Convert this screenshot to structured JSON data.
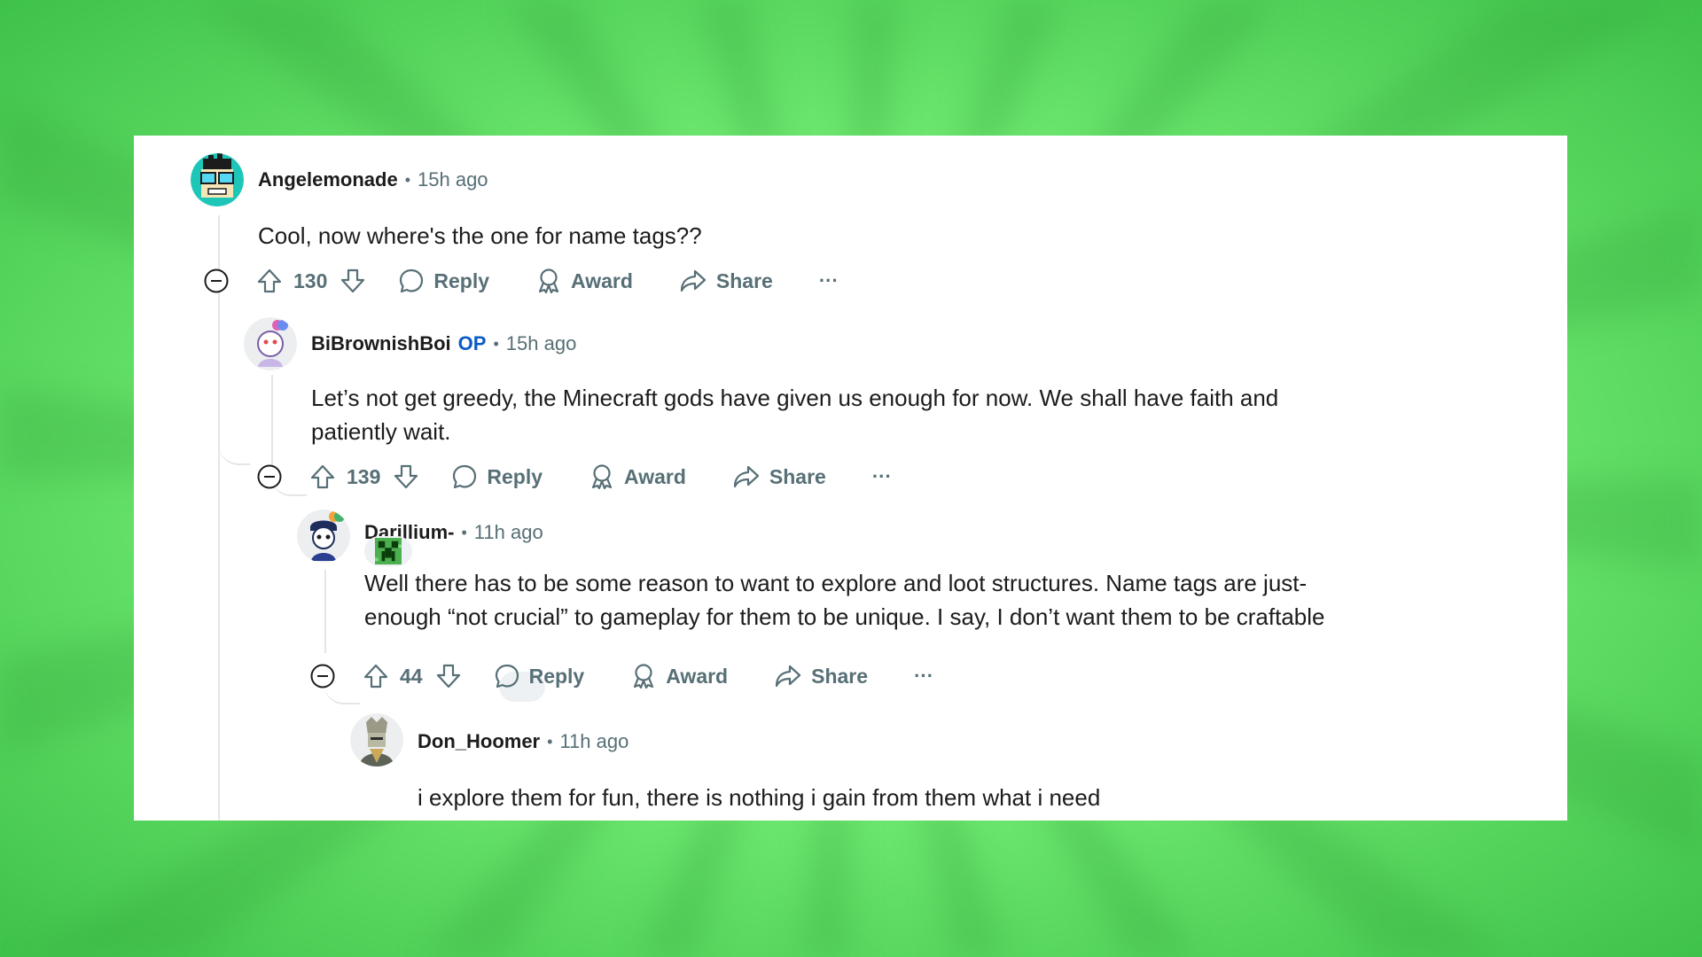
{
  "colors": {
    "background": "#7bf27a",
    "card": "#ffffff",
    "text": "#1c1c1c",
    "muted": "#576f76",
    "op_badge": "#0a5bc4",
    "thread_line": "#e3e6e8"
  },
  "comments": [
    {
      "author": "Angelemonade",
      "separator": "•",
      "time": "15h ago",
      "body": [
        "Cool, now where's the one for name tags??"
      ],
      "score": "130",
      "reply_label": "Reply",
      "award_label": "Award",
      "share_label": "Share",
      "more_label": "···",
      "avatar_icon": "avatar-glasses-icon"
    },
    {
      "author": "BiBrownishBoi",
      "badge": "OP",
      "separator": "•",
      "time": "15h ago",
      "body": [
        "Let’s not get greedy, the Minecraft gods have given us enough for now. We shall have faith and",
        "patiently wait."
      ],
      "score": "139",
      "reply_label": "Reply",
      "award_label": "Award",
      "share_label": "Share",
      "more_label": "···",
      "avatar_icon": "avatar-snoo-icon"
    },
    {
      "author": "Darillium-",
      "separator": "•",
      "time": "11h ago",
      "flair_icon": "creeper-flair-icon",
      "body": [
        "Well there has to be some reason to want to explore and loot structures. Name tags are just-",
        "enough “not crucial” to gameplay for them to be unique. I say, I don’t want them to be craftable"
      ],
      "score": "44",
      "reply_label": "Reply",
      "award_label": "Award",
      "share_label": "Share",
      "more_label": "···",
      "avatar_icon": "avatar-snoo-cap-icon"
    },
    {
      "author": "Don_Hoomer",
      "separator": "•",
      "time": "11h ago",
      "body": [
        "i explore them for fun, there is nothing i gain from them what i need"
      ],
      "avatar_icon": "avatar-knight-icon"
    }
  ]
}
